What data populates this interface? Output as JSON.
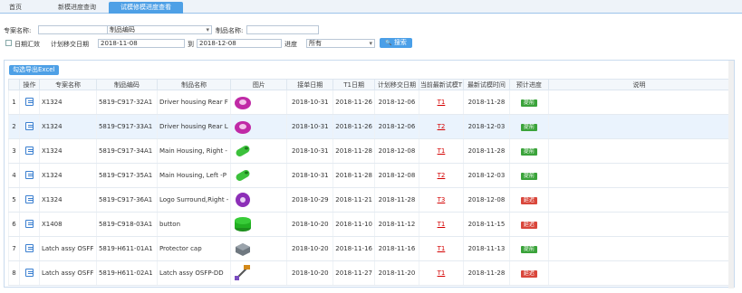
{
  "tabs": [
    {
      "label": "首页"
    },
    {
      "label": "新模进度查询"
    },
    {
      "label": "试模修模进度查看"
    }
  ],
  "filters": {
    "project_label": "专案名称:",
    "project_value": "",
    "part_no_value": "制品编码",
    "part_name_label": "制品名称:",
    "part_name_value": "",
    "date_checkbox_label": "日期汇效",
    "plan_date_label": "计划移交日期",
    "date_from": "2018-11-08",
    "date_to_label": "到",
    "date_to": "2018-12-08",
    "progress_label": "进度",
    "progress_value": "所有",
    "search_label": "搜索",
    "search_icon_glyph": "🔍"
  },
  "table": {
    "export_label": "勾选导出Excel",
    "edit_icon_name": "edit-icon",
    "columns": [
      "操作",
      "专案名称",
      "制品编码",
      "制品名称",
      "图片",
      "接单日期",
      "T1日期",
      "计划移交日期",
      "当前最新试模T",
      "最新试模时间",
      "预计进度",
      "说明"
    ],
    "rows": [
      {
        "num": "1",
        "project": "X1324",
        "code": "5819-C917-32A1",
        "name": "Driver housing Rear F",
        "img": "pink-ring",
        "order_date": "2018-10-31",
        "t1_date": "2018-11-26",
        "plan_date": "2018-12-06",
        "trial": "T1",
        "trial_time": "2018-11-28",
        "status": "提前",
        "status_color": "#3aa33a",
        "note": ""
      },
      {
        "num": "2",
        "project": "X1324",
        "code": "5819-C917-33A1",
        "name": "Driver housing Rear L",
        "img": "pink-ring",
        "order_date": "2018-10-31",
        "t1_date": "2018-11-26",
        "plan_date": "2018-12-06",
        "trial": "T2",
        "trial_time": "2018-12-03",
        "status": "提前",
        "status_color": "#3aa33a",
        "note": ""
      },
      {
        "num": "3",
        "project": "X1324",
        "code": "5819-C917-34A1",
        "name": "Main Housing, Right -",
        "img": "green-tube",
        "order_date": "2018-10-31",
        "t1_date": "2018-11-28",
        "plan_date": "2018-12-08",
        "trial": "T1",
        "trial_time": "2018-11-28",
        "status": "提前",
        "status_color": "#3aa33a",
        "note": ""
      },
      {
        "num": "4",
        "project": "X1324",
        "code": "5819-C917-35A1",
        "name": "Main Housing, Left -P",
        "img": "green-tube",
        "order_date": "2018-10-31",
        "t1_date": "2018-11-28",
        "plan_date": "2018-12-08",
        "trial": "T2",
        "trial_time": "2018-12-03",
        "status": "提前",
        "status_color": "#3aa33a",
        "note": ""
      },
      {
        "num": "5",
        "project": "X1324",
        "code": "5819-C917-36A1",
        "name": "Logo Surround,Right -",
        "img": "purple-ring",
        "order_date": "2018-10-29",
        "t1_date": "2018-11-21",
        "plan_date": "2018-11-28",
        "trial": "T3",
        "trial_time": "2018-12-08",
        "status": "延迟",
        "status_color": "#d9463b",
        "note": ""
      },
      {
        "num": "6",
        "project": "X1408",
        "code": "5819-C918-03A1",
        "name": "button",
        "img": "green-button",
        "order_date": "2018-10-20",
        "t1_date": "2018-11-10",
        "plan_date": "2018-11-12",
        "trial": "T1",
        "trial_time": "2018-11-15",
        "status": "延迟",
        "status_color": "#d9463b",
        "note": ""
      },
      {
        "num": "7",
        "project": "Latch assy OSFF",
        "code": "5819-H611-01A1",
        "name": "Protector cap",
        "img": "grey-cap",
        "order_date": "2018-10-20",
        "t1_date": "2018-11-16",
        "plan_date": "2018-11-16",
        "trial": "T1",
        "trial_time": "2018-11-13",
        "status": "提前",
        "status_color": "#3aa33a",
        "note": ""
      },
      {
        "num": "8",
        "project": "Latch assy OSFF",
        "code": "5819-H611-02A1",
        "name": "Latch assy OSFP-DD",
        "img": "latch",
        "order_date": "2018-10-20",
        "t1_date": "2018-11-27",
        "plan_date": "2018-11-20",
        "trial": "T1",
        "trial_time": "2018-11-28",
        "status": "延迟",
        "status_color": "#d9463b",
        "note": ""
      }
    ]
  }
}
